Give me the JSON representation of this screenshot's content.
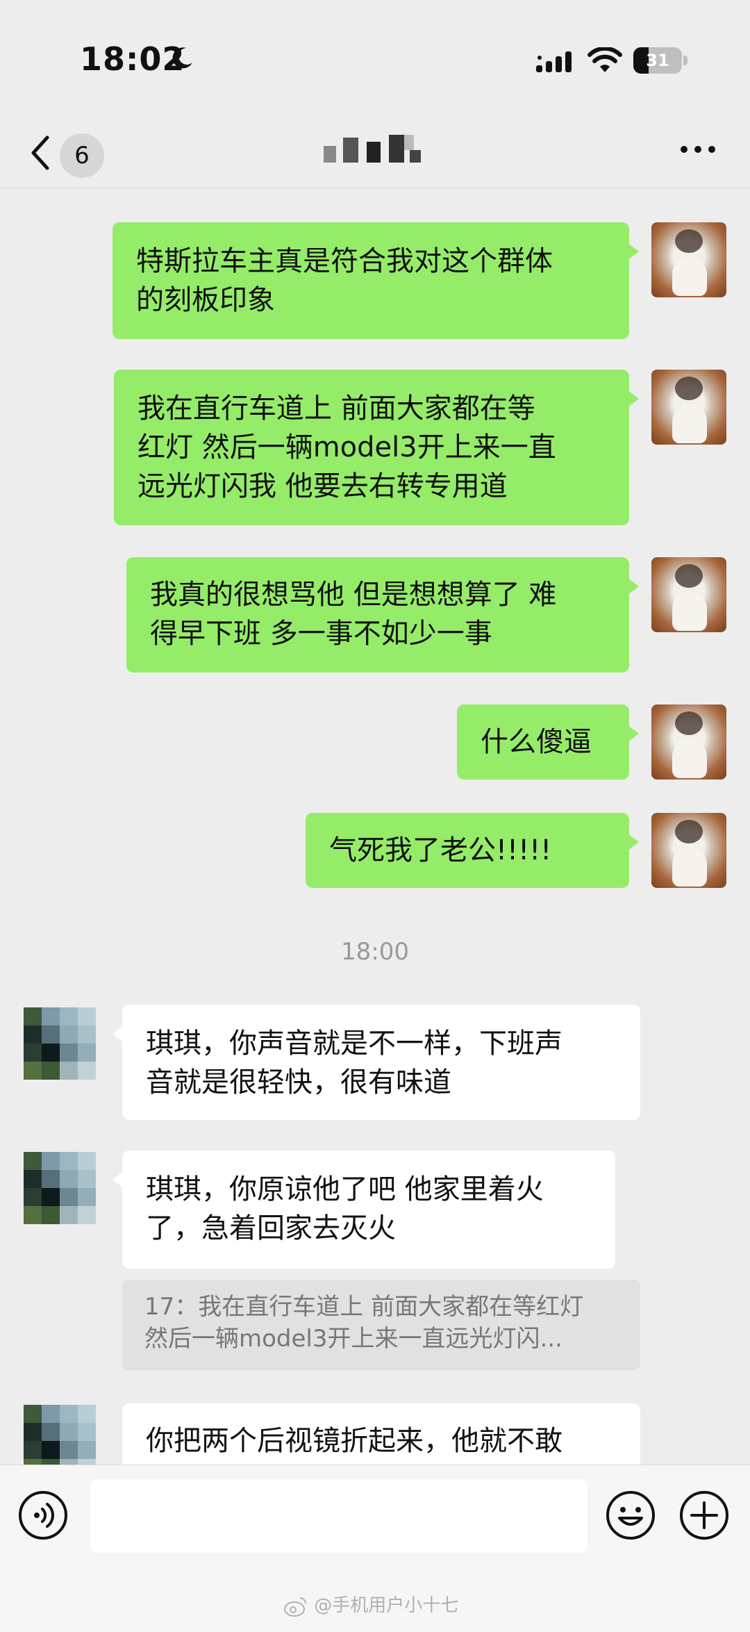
{
  "status_bar": {
    "time": "18:02",
    "battery_level": "31"
  },
  "header": {
    "unread_count": "6"
  },
  "messages_out": [
    {
      "lines": [
        "特斯拉车主真是符合我对这个群体",
        "的刻板印象"
      ]
    },
    {
      "lines": [
        "我在直行车道上 前面大家都在等",
        "红灯 然后一辆model3开上来一直",
        "远光灯闪我 他要去右转专用道"
      ]
    },
    {
      "lines": [
        "我真的很想骂他 但是想想算了 难",
        "得早下班 多一事不如少一事"
      ]
    },
    {
      "lines": [
        "什么傻逼"
      ]
    },
    {
      "lines": [
        "气死我了老公!!!!!"
      ]
    }
  ],
  "timestamp": "18:00",
  "messages_in": [
    {
      "lines": [
        "琪琪，你声音就是不一样，下班声",
        "音就是很轻快，很有味道"
      ]
    },
    {
      "lines": [
        "琪琪，你原谅他了吧 他家里着火",
        "了，急着回家去灭火"
      ]
    },
    {
      "lines": [
        "你把两个后视镜折起来，他就不敢"
      ]
    }
  ],
  "quote": {
    "lines": [
      "17：我在直行车道上 前面大家都在等红灯",
      "然后一辆model3开上来一直远光灯闪..."
    ]
  },
  "watermark": "@手机用户小十七",
  "colors": {
    "background": "#ededed",
    "outgoing_bubble": "#95ec69",
    "incoming_bubble": "#ffffff"
  }
}
